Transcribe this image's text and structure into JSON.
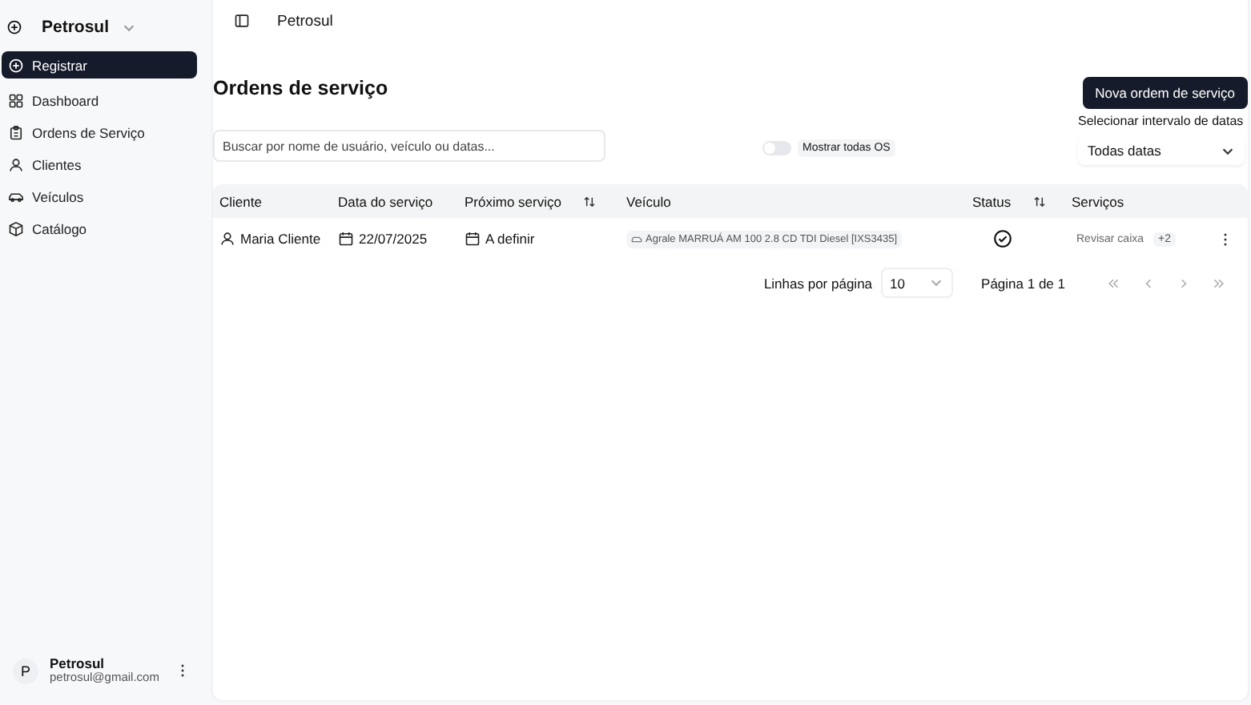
{
  "sidebar": {
    "org": "Petrosul",
    "items": [
      {
        "label": "Registrar",
        "kind": "plus",
        "selected": true
      },
      {
        "label": "Dashboard",
        "kind": "grid",
        "selected": false
      },
      {
        "label": "Ordens de Serviço",
        "kind": "clipboard",
        "selected": false
      },
      {
        "label": "Clientes",
        "kind": "person",
        "selected": false
      },
      {
        "label": "Veículos",
        "kind": "car",
        "selected": false
      },
      {
        "label": "Catálogo",
        "kind": "box",
        "selected": false
      }
    ],
    "user": {
      "initial": "P",
      "name": "Petrosul",
      "email": "petrosul@gmail.com"
    }
  },
  "header": {
    "title": "Petrosul"
  },
  "page": {
    "title": "Ordens de serviço",
    "new_button": "Nova ordem de serviço",
    "search": {
      "placeholder": "Buscar por nome de usuário, veículo ou datas..."
    },
    "toggle": {
      "label": "Mostrar todas OS",
      "on": false
    },
    "date_range": {
      "label": "Selecionar intervalo de datas",
      "value": "Todas datas"
    }
  },
  "table": {
    "columns": [
      {
        "label": "Cliente",
        "sortable": false
      },
      {
        "label": "Data do serviço",
        "sortable": false
      },
      {
        "label": "Próximo serviço",
        "sortable": true
      },
      {
        "label": "Veículo",
        "sortable": false
      },
      {
        "label": "Status",
        "sortable": true
      },
      {
        "label": "Serviços",
        "sortable": false
      }
    ],
    "rows": [
      {
        "client": "Maria Cliente",
        "date": "22/07/2025",
        "next": "A definir",
        "vehicle": "Agrale MARRUÁ AM 100 2.8 CD TDI Diesel [IXS3435]",
        "completed": true,
        "service": "Revisar caixa",
        "more": "+2"
      }
    ]
  },
  "pagination": {
    "rows_label": "Linhas por página",
    "rows_value": "10",
    "page": "Página 1 de 1",
    "disabled": true
  }
}
